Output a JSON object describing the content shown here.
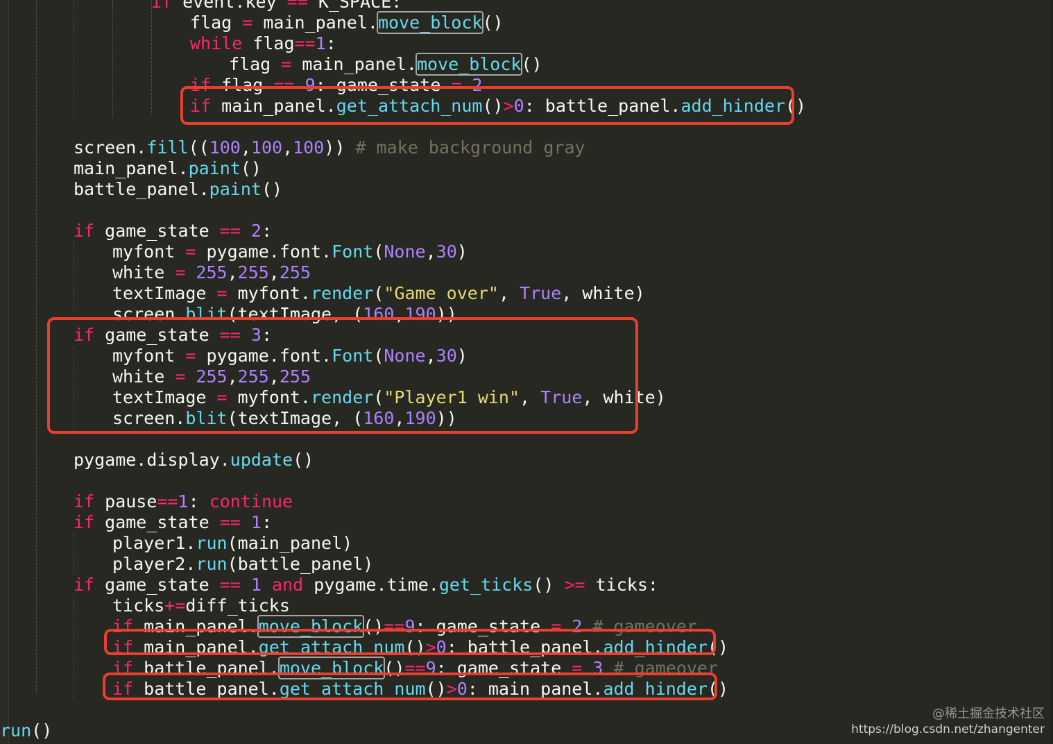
{
  "editor": {
    "theme_colors": {
      "background": "#272822",
      "plain": "#f8f8f2",
      "keyword": "#f92672",
      "operator": "#f92672",
      "function": "#66d9ef",
      "number": "#ae81ff",
      "constant": "#ae81ff",
      "string": "#e6db74",
      "comment": "#75715e",
      "annotation_box": "#e8402e"
    },
    "lines": [
      {
        "indent": 4,
        "tokens": [
          {
            "t": "if ",
            "c": "kw"
          },
          {
            "t": "event.key ",
            "c": "p"
          },
          {
            "t": "== ",
            "c": "op"
          },
          {
            "t": "K_SPACE:",
            "c": "p"
          }
        ]
      },
      {
        "indent": 5,
        "tokens": [
          {
            "t": "flag ",
            "c": "p"
          },
          {
            "t": "= ",
            "c": "op"
          },
          {
            "t": "main_panel.",
            "c": "p"
          },
          {
            "t": "move_block",
            "c": "fn",
            "box": true
          },
          {
            "t": "()",
            "c": "p"
          }
        ]
      },
      {
        "indent": 5,
        "tokens": [
          {
            "t": "while ",
            "c": "kw"
          },
          {
            "t": "flag",
            "c": "p"
          },
          {
            "t": "==",
            "c": "op"
          },
          {
            "t": "1",
            "c": "num"
          },
          {
            "t": ":",
            "c": "p"
          }
        ]
      },
      {
        "indent": 6,
        "tokens": [
          {
            "t": "flag ",
            "c": "p"
          },
          {
            "t": "= ",
            "c": "op"
          },
          {
            "t": "main_panel.",
            "c": "p"
          },
          {
            "t": "move_block",
            "c": "fn",
            "box": true
          },
          {
            "t": "()",
            "c": "p"
          }
        ]
      },
      {
        "indent": 5,
        "tokens": [
          {
            "t": "if ",
            "c": "kw"
          },
          {
            "t": "flag ",
            "c": "p"
          },
          {
            "t": "== ",
            "c": "op"
          },
          {
            "t": "9",
            "c": "num"
          },
          {
            "t": ": game_state ",
            "c": "p"
          },
          {
            "t": "= ",
            "c": "op"
          },
          {
            "t": "2",
            "c": "num"
          }
        ]
      },
      {
        "indent": 5,
        "tokens": [
          {
            "t": "if ",
            "c": "kw"
          },
          {
            "t": "main_panel.",
            "c": "p"
          },
          {
            "t": "get_attach_num",
            "c": "fn"
          },
          {
            "t": "()",
            "c": "p"
          },
          {
            "t": ">",
            "c": "op"
          },
          {
            "t": "0",
            "c": "num"
          },
          {
            "t": ": battle_panel.",
            "c": "p"
          },
          {
            "t": "add_hinder",
            "c": "fn"
          },
          {
            "t": "()",
            "c": "p"
          }
        ]
      },
      {
        "indent": 0,
        "tokens": []
      },
      {
        "indent": 2,
        "tokens": [
          {
            "t": "screen.",
            "c": "p"
          },
          {
            "t": "fill",
            "c": "fn"
          },
          {
            "t": "((",
            "c": "p"
          },
          {
            "t": "100",
            "c": "num"
          },
          {
            "t": ",",
            "c": "p"
          },
          {
            "t": "100",
            "c": "num"
          },
          {
            "t": ",",
            "c": "p"
          },
          {
            "t": "100",
            "c": "num"
          },
          {
            "t": ")) ",
            "c": "p"
          },
          {
            "t": "# make background gray",
            "c": "cm"
          }
        ]
      },
      {
        "indent": 2,
        "tokens": [
          {
            "t": "main_panel.",
            "c": "p"
          },
          {
            "t": "paint",
            "c": "fn"
          },
          {
            "t": "()",
            "c": "p"
          }
        ]
      },
      {
        "indent": 2,
        "tokens": [
          {
            "t": "battle_panel.",
            "c": "p"
          },
          {
            "t": "paint",
            "c": "fn"
          },
          {
            "t": "()",
            "c": "p"
          }
        ]
      },
      {
        "indent": 0,
        "tokens": []
      },
      {
        "indent": 2,
        "tokens": [
          {
            "t": "if ",
            "c": "kw"
          },
          {
            "t": "game_state ",
            "c": "p"
          },
          {
            "t": "== ",
            "c": "op"
          },
          {
            "t": "2",
            "c": "num"
          },
          {
            "t": ":",
            "c": "p"
          }
        ]
      },
      {
        "indent": 3,
        "tokens": [
          {
            "t": "myfont ",
            "c": "p"
          },
          {
            "t": "= ",
            "c": "op"
          },
          {
            "t": "pygame.font.",
            "c": "p"
          },
          {
            "t": "Font",
            "c": "fn"
          },
          {
            "t": "(",
            "c": "p"
          },
          {
            "t": "None",
            "c": "num"
          },
          {
            "t": ",",
            "c": "p"
          },
          {
            "t": "30",
            "c": "num"
          },
          {
            "t": ")",
            "c": "p"
          }
        ]
      },
      {
        "indent": 3,
        "tokens": [
          {
            "t": "white ",
            "c": "p"
          },
          {
            "t": "= ",
            "c": "op"
          },
          {
            "t": "255",
            "c": "num"
          },
          {
            "t": ",",
            "c": "p"
          },
          {
            "t": "255",
            "c": "num"
          },
          {
            "t": ",",
            "c": "p"
          },
          {
            "t": "255",
            "c": "num"
          }
        ]
      },
      {
        "indent": 3,
        "tokens": [
          {
            "t": "textImage ",
            "c": "p"
          },
          {
            "t": "= ",
            "c": "op"
          },
          {
            "t": "myfont.",
            "c": "p"
          },
          {
            "t": "render",
            "c": "fn"
          },
          {
            "t": "(",
            "c": "p"
          },
          {
            "t": "\"Game over\"",
            "c": "str"
          },
          {
            "t": ", ",
            "c": "p"
          },
          {
            "t": "True",
            "c": "num"
          },
          {
            "t": ", white)",
            "c": "p"
          }
        ]
      },
      {
        "indent": 3,
        "tokens": [
          {
            "t": "screen.",
            "c": "p"
          },
          {
            "t": "blit",
            "c": "fn"
          },
          {
            "t": "(textImage, (",
            "c": "p"
          },
          {
            "t": "160",
            "c": "num"
          },
          {
            "t": ",",
            "c": "p"
          },
          {
            "t": "190",
            "c": "num"
          },
          {
            "t": "))",
            "c": "p"
          }
        ]
      },
      {
        "indent": 2,
        "tokens": [
          {
            "t": "if ",
            "c": "kw"
          },
          {
            "t": "game_state ",
            "c": "p"
          },
          {
            "t": "== ",
            "c": "op"
          },
          {
            "t": "3",
            "c": "num"
          },
          {
            "t": ":",
            "c": "p"
          }
        ]
      },
      {
        "indent": 3,
        "tokens": [
          {
            "t": "myfont ",
            "c": "p"
          },
          {
            "t": "= ",
            "c": "op"
          },
          {
            "t": "pygame.font.",
            "c": "p"
          },
          {
            "t": "Font",
            "c": "fn"
          },
          {
            "t": "(",
            "c": "p"
          },
          {
            "t": "None",
            "c": "num"
          },
          {
            "t": ",",
            "c": "p"
          },
          {
            "t": "30",
            "c": "num"
          },
          {
            "t": ")",
            "c": "p"
          }
        ]
      },
      {
        "indent": 3,
        "tokens": [
          {
            "t": "white ",
            "c": "p"
          },
          {
            "t": "= ",
            "c": "op"
          },
          {
            "t": "255",
            "c": "num"
          },
          {
            "t": ",",
            "c": "p"
          },
          {
            "t": "255",
            "c": "num"
          },
          {
            "t": ",",
            "c": "p"
          },
          {
            "t": "255",
            "c": "num"
          }
        ]
      },
      {
        "indent": 3,
        "tokens": [
          {
            "t": "textImage ",
            "c": "p"
          },
          {
            "t": "= ",
            "c": "op"
          },
          {
            "t": "myfont.",
            "c": "p"
          },
          {
            "t": "render",
            "c": "fn"
          },
          {
            "t": "(",
            "c": "p"
          },
          {
            "t": "\"Player1 win\"",
            "c": "str"
          },
          {
            "t": ", ",
            "c": "p"
          },
          {
            "t": "True",
            "c": "num"
          },
          {
            "t": ", white)",
            "c": "p"
          }
        ]
      },
      {
        "indent": 3,
        "tokens": [
          {
            "t": "screen.",
            "c": "p"
          },
          {
            "t": "blit",
            "c": "fn"
          },
          {
            "t": "(textImage, (",
            "c": "p"
          },
          {
            "t": "160",
            "c": "num"
          },
          {
            "t": ",",
            "c": "p"
          },
          {
            "t": "190",
            "c": "num"
          },
          {
            "t": "))",
            "c": "p"
          }
        ]
      },
      {
        "indent": 0,
        "tokens": []
      },
      {
        "indent": 2,
        "tokens": [
          {
            "t": "pygame.display.",
            "c": "p"
          },
          {
            "t": "update",
            "c": "fn"
          },
          {
            "t": "()",
            "c": "p"
          }
        ]
      },
      {
        "indent": 0,
        "tokens": []
      },
      {
        "indent": 2,
        "tokens": [
          {
            "t": "if ",
            "c": "kw"
          },
          {
            "t": "pause",
            "c": "p"
          },
          {
            "t": "==",
            "c": "op"
          },
          {
            "t": "1",
            "c": "num"
          },
          {
            "t": ": ",
            "c": "p"
          },
          {
            "t": "continue",
            "c": "kw"
          }
        ]
      },
      {
        "indent": 2,
        "tokens": [
          {
            "t": "if ",
            "c": "kw"
          },
          {
            "t": "game_state ",
            "c": "p"
          },
          {
            "t": "== ",
            "c": "op"
          },
          {
            "t": "1",
            "c": "num"
          },
          {
            "t": ":",
            "c": "p"
          }
        ]
      },
      {
        "indent": 3,
        "tokens": [
          {
            "t": "player1.",
            "c": "p"
          },
          {
            "t": "run",
            "c": "fn"
          },
          {
            "t": "(main_panel)",
            "c": "p"
          }
        ]
      },
      {
        "indent": 3,
        "tokens": [
          {
            "t": "player2.",
            "c": "p"
          },
          {
            "t": "run",
            "c": "fn"
          },
          {
            "t": "(battle_panel)",
            "c": "p"
          }
        ]
      },
      {
        "indent": 2,
        "tokens": [
          {
            "t": "if ",
            "c": "kw"
          },
          {
            "t": "game_state ",
            "c": "p"
          },
          {
            "t": "== ",
            "c": "op"
          },
          {
            "t": "1 ",
            "c": "num"
          },
          {
            "t": "and ",
            "c": "kw"
          },
          {
            "t": "pygame.time.",
            "c": "p"
          },
          {
            "t": "get_ticks",
            "c": "fn"
          },
          {
            "t": "() ",
            "c": "p"
          },
          {
            "t": ">= ",
            "c": "op"
          },
          {
            "t": "ticks:",
            "c": "p"
          }
        ]
      },
      {
        "indent": 3,
        "tokens": [
          {
            "t": "ticks",
            "c": "p"
          },
          {
            "t": "+=",
            "c": "op"
          },
          {
            "t": "diff_ticks",
            "c": "p"
          }
        ]
      },
      {
        "indent": 3,
        "tokens": [
          {
            "t": "if ",
            "c": "kw"
          },
          {
            "t": "main_panel.",
            "c": "p"
          },
          {
            "t": "move_block",
            "c": "fn",
            "box": true
          },
          {
            "t": "()",
            "c": "p"
          },
          {
            "t": "==",
            "c": "op"
          },
          {
            "t": "9",
            "c": "num"
          },
          {
            "t": ": game_state ",
            "c": "p"
          },
          {
            "t": "= ",
            "c": "op"
          },
          {
            "t": "2 ",
            "c": "num"
          },
          {
            "t": "# gameover",
            "c": "cm"
          }
        ]
      },
      {
        "indent": 3,
        "tokens": [
          {
            "t": "if ",
            "c": "kw"
          },
          {
            "t": "main_panel.",
            "c": "p"
          },
          {
            "t": "get_attach_num",
            "c": "fn"
          },
          {
            "t": "()",
            "c": "p"
          },
          {
            "t": ">",
            "c": "op"
          },
          {
            "t": "0",
            "c": "num"
          },
          {
            "t": ": battle_panel.",
            "c": "p"
          },
          {
            "t": "add_hinder",
            "c": "fn"
          },
          {
            "t": "()",
            "c": "p"
          }
        ]
      },
      {
        "indent": 3,
        "tokens": [
          {
            "t": "if ",
            "c": "kw"
          },
          {
            "t": "battle_panel.",
            "c": "p"
          },
          {
            "t": "move_block",
            "c": "fn",
            "box": true
          },
          {
            "t": "()",
            "c": "p"
          },
          {
            "t": "==",
            "c": "op"
          },
          {
            "t": "9",
            "c": "num"
          },
          {
            "t": ": game_state ",
            "c": "p"
          },
          {
            "t": "= ",
            "c": "op"
          },
          {
            "t": "3 ",
            "c": "num"
          },
          {
            "t": "# gameover",
            "c": "cm"
          }
        ]
      },
      {
        "indent": 3,
        "tokens": [
          {
            "t": "if ",
            "c": "kw"
          },
          {
            "t": "battle_panel.",
            "c": "p"
          },
          {
            "t": "get_attach_num",
            "c": "fn"
          },
          {
            "t": "()",
            "c": "p"
          },
          {
            "t": ">",
            "c": "op"
          },
          {
            "t": "0",
            "c": "num"
          },
          {
            "t": ": main_panel.",
            "c": "p"
          },
          {
            "t": "add_hinder",
            "c": "fn"
          },
          {
            "t": "()",
            "c": "p"
          }
        ]
      },
      {
        "indent": 0,
        "tokens": []
      },
      {
        "indent": -1,
        "tokens": [
          {
            "t": "run",
            "c": "fn"
          },
          {
            "t": "()",
            "c": "p"
          }
        ]
      }
    ],
    "highlight_boxes": [
      {
        "label": "annotated-line-get-attach-main"
      },
      {
        "label": "annotated-block-game-state-3"
      },
      {
        "label": "annotated-line-main-add-hinder"
      },
      {
        "label": "annotated-line-battle-add-hinder"
      }
    ]
  },
  "watermark": {
    "brand": "@稀土掘金技术社区",
    "url": "https://blog.csdn.net/zhangenter"
  }
}
